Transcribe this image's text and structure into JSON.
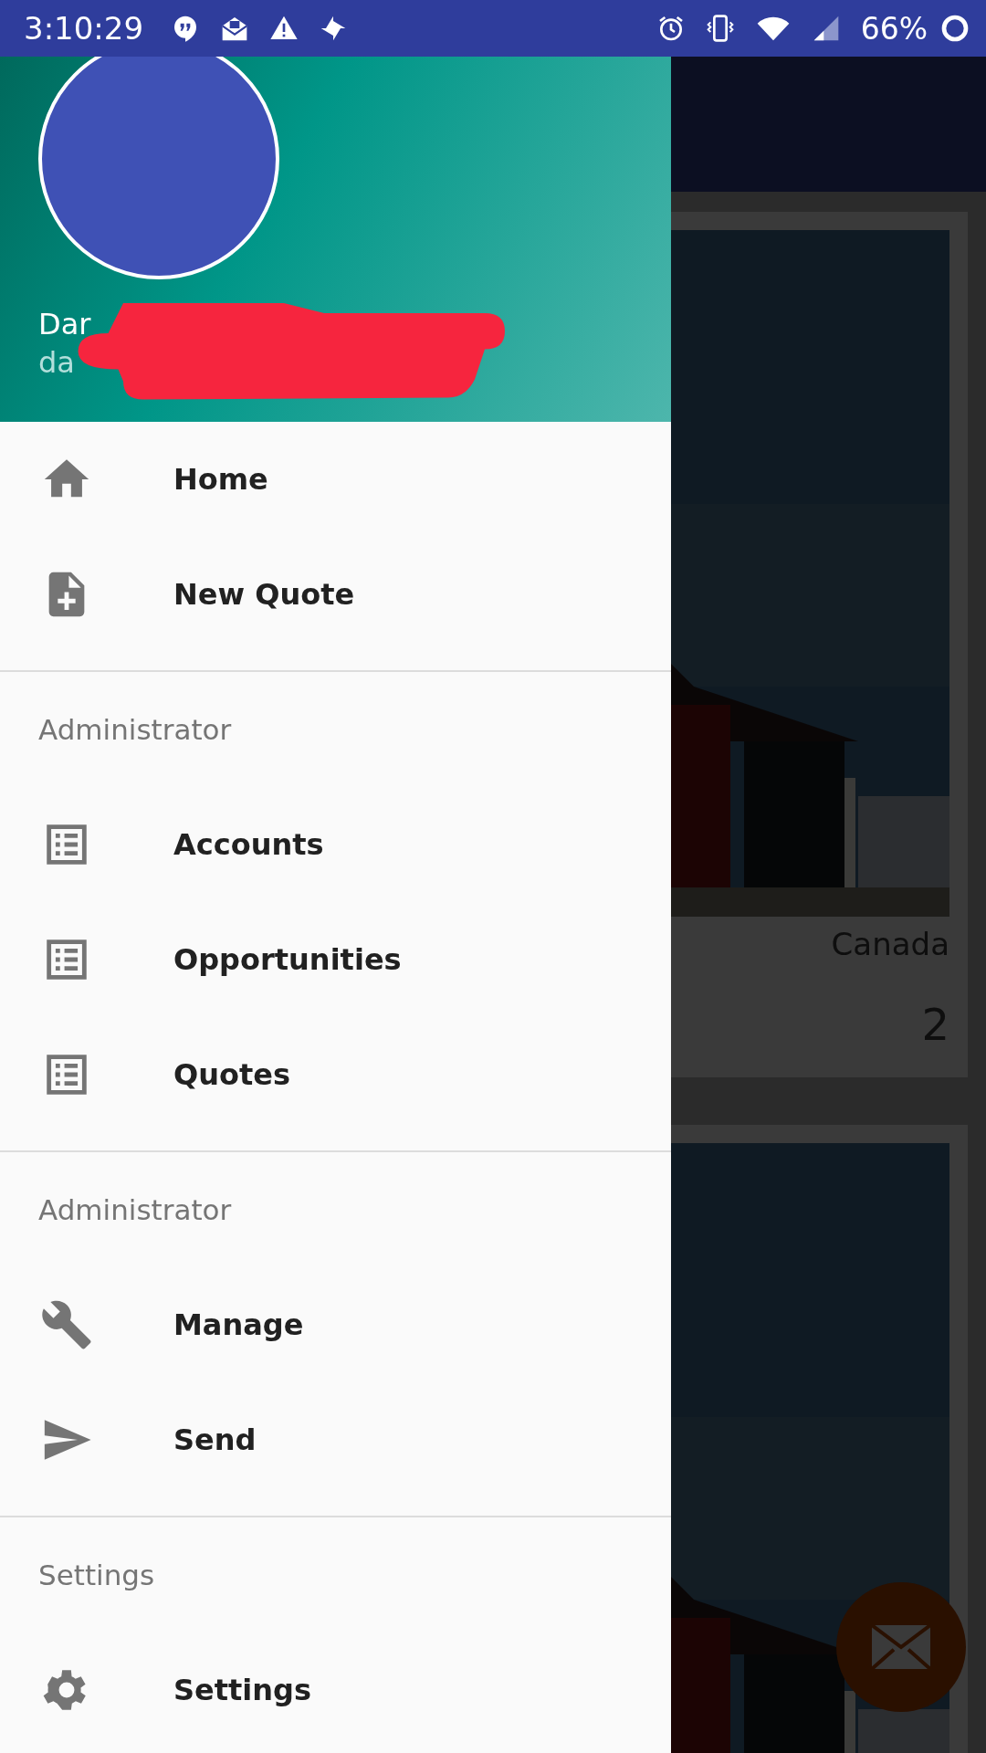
{
  "status_bar": {
    "time": "3:10:29",
    "battery": "66%"
  },
  "drawer": {
    "header": {
      "name": "Dar",
      "email": "da"
    },
    "sections": [
      {
        "items": [
          {
            "label": "Home",
            "kind": "home"
          },
          {
            "label": "New Quote",
            "kind": "document"
          }
        ]
      },
      {
        "title": "Administrator",
        "items": [
          {
            "label": "Accounts",
            "kind": "list"
          },
          {
            "label": "Opportunities",
            "kind": "list"
          },
          {
            "label": "Quotes",
            "kind": "list"
          }
        ]
      },
      {
        "title": "Administrator",
        "items": [
          {
            "label": "Manage",
            "kind": "tool"
          },
          {
            "label": "Send",
            "kind": "send"
          }
        ]
      },
      {
        "title": "Settings",
        "items": [
          {
            "label": "Settings",
            "kind": "settings"
          }
        ]
      }
    ]
  },
  "content": {
    "cards": [
      {
        "kind": "picture",
        "location": "Canada",
        "count": "2"
      },
      {
        "kind": "picture"
      }
    ]
  }
}
